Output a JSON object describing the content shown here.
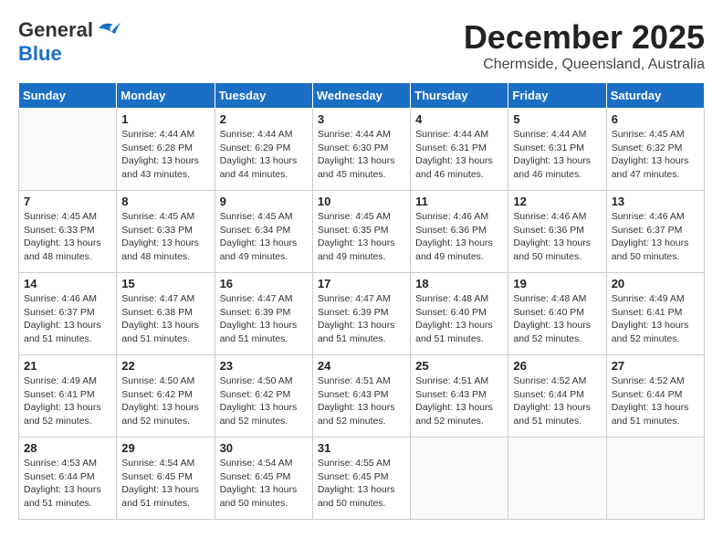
{
  "logo": {
    "general": "General",
    "blue": "Blue"
  },
  "header": {
    "month": "December 2025",
    "location": "Chermside, Queensland, Australia"
  },
  "weekdays": [
    "Sunday",
    "Monday",
    "Tuesday",
    "Wednesday",
    "Thursday",
    "Friday",
    "Saturday"
  ],
  "weeks": [
    [
      {
        "day": "",
        "info": ""
      },
      {
        "day": "1",
        "info": "Sunrise: 4:44 AM\nSunset: 6:28 PM\nDaylight: 13 hours\nand 43 minutes."
      },
      {
        "day": "2",
        "info": "Sunrise: 4:44 AM\nSunset: 6:29 PM\nDaylight: 13 hours\nand 44 minutes."
      },
      {
        "day": "3",
        "info": "Sunrise: 4:44 AM\nSunset: 6:30 PM\nDaylight: 13 hours\nand 45 minutes."
      },
      {
        "day": "4",
        "info": "Sunrise: 4:44 AM\nSunset: 6:31 PM\nDaylight: 13 hours\nand 46 minutes."
      },
      {
        "day": "5",
        "info": "Sunrise: 4:44 AM\nSunset: 6:31 PM\nDaylight: 13 hours\nand 46 minutes."
      },
      {
        "day": "6",
        "info": "Sunrise: 4:45 AM\nSunset: 6:32 PM\nDaylight: 13 hours\nand 47 minutes."
      }
    ],
    [
      {
        "day": "7",
        "info": "Sunrise: 4:45 AM\nSunset: 6:33 PM\nDaylight: 13 hours\nand 48 minutes."
      },
      {
        "day": "8",
        "info": "Sunrise: 4:45 AM\nSunset: 6:33 PM\nDaylight: 13 hours\nand 48 minutes."
      },
      {
        "day": "9",
        "info": "Sunrise: 4:45 AM\nSunset: 6:34 PM\nDaylight: 13 hours\nand 49 minutes."
      },
      {
        "day": "10",
        "info": "Sunrise: 4:45 AM\nSunset: 6:35 PM\nDaylight: 13 hours\nand 49 minutes."
      },
      {
        "day": "11",
        "info": "Sunrise: 4:46 AM\nSunset: 6:36 PM\nDaylight: 13 hours\nand 49 minutes."
      },
      {
        "day": "12",
        "info": "Sunrise: 4:46 AM\nSunset: 6:36 PM\nDaylight: 13 hours\nand 50 minutes."
      },
      {
        "day": "13",
        "info": "Sunrise: 4:46 AM\nSunset: 6:37 PM\nDaylight: 13 hours\nand 50 minutes."
      }
    ],
    [
      {
        "day": "14",
        "info": "Sunrise: 4:46 AM\nSunset: 6:37 PM\nDaylight: 13 hours\nand 51 minutes."
      },
      {
        "day": "15",
        "info": "Sunrise: 4:47 AM\nSunset: 6:38 PM\nDaylight: 13 hours\nand 51 minutes."
      },
      {
        "day": "16",
        "info": "Sunrise: 4:47 AM\nSunset: 6:39 PM\nDaylight: 13 hours\nand 51 minutes."
      },
      {
        "day": "17",
        "info": "Sunrise: 4:47 AM\nSunset: 6:39 PM\nDaylight: 13 hours\nand 51 minutes."
      },
      {
        "day": "18",
        "info": "Sunrise: 4:48 AM\nSunset: 6:40 PM\nDaylight: 13 hours\nand 51 minutes."
      },
      {
        "day": "19",
        "info": "Sunrise: 4:48 AM\nSunset: 6:40 PM\nDaylight: 13 hours\nand 52 minutes."
      },
      {
        "day": "20",
        "info": "Sunrise: 4:49 AM\nSunset: 6:41 PM\nDaylight: 13 hours\nand 52 minutes."
      }
    ],
    [
      {
        "day": "21",
        "info": "Sunrise: 4:49 AM\nSunset: 6:41 PM\nDaylight: 13 hours\nand 52 minutes."
      },
      {
        "day": "22",
        "info": "Sunrise: 4:50 AM\nSunset: 6:42 PM\nDaylight: 13 hours\nand 52 minutes."
      },
      {
        "day": "23",
        "info": "Sunrise: 4:50 AM\nSunset: 6:42 PM\nDaylight: 13 hours\nand 52 minutes."
      },
      {
        "day": "24",
        "info": "Sunrise: 4:51 AM\nSunset: 6:43 PM\nDaylight: 13 hours\nand 52 minutes."
      },
      {
        "day": "25",
        "info": "Sunrise: 4:51 AM\nSunset: 6:43 PM\nDaylight: 13 hours\nand 52 minutes."
      },
      {
        "day": "26",
        "info": "Sunrise: 4:52 AM\nSunset: 6:44 PM\nDaylight: 13 hours\nand 51 minutes."
      },
      {
        "day": "27",
        "info": "Sunrise: 4:52 AM\nSunset: 6:44 PM\nDaylight: 13 hours\nand 51 minutes."
      }
    ],
    [
      {
        "day": "28",
        "info": "Sunrise: 4:53 AM\nSunset: 6:44 PM\nDaylight: 13 hours\nand 51 minutes."
      },
      {
        "day": "29",
        "info": "Sunrise: 4:54 AM\nSunset: 6:45 PM\nDaylight: 13 hours\nand 51 minutes."
      },
      {
        "day": "30",
        "info": "Sunrise: 4:54 AM\nSunset: 6:45 PM\nDaylight: 13 hours\nand 50 minutes."
      },
      {
        "day": "31",
        "info": "Sunrise: 4:55 AM\nSunset: 6:45 PM\nDaylight: 13 hours\nand 50 minutes."
      },
      {
        "day": "",
        "info": ""
      },
      {
        "day": "",
        "info": ""
      },
      {
        "day": "",
        "info": ""
      }
    ]
  ]
}
